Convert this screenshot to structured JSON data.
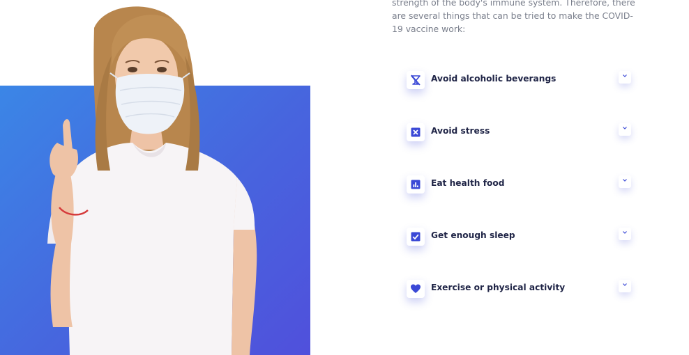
{
  "intro": {
    "text": "strength of the body's immune system. Therefore, there are several things that can be tried to make the COVID-19 vaccine work:"
  },
  "hero": {
    "image_description_icon": "woman-with-mask-illustration"
  },
  "colors": {
    "accent": "#3b49d6",
    "panel_start": "#3b86e6",
    "panel_end": "#5050dc",
    "title": "#1f2446",
    "body": "#7a7f8c"
  },
  "faq": {
    "items": [
      {
        "label": "Avoid alcoholic beverangs",
        "icon": "no-alcohol-icon"
      },
      {
        "label": "Avoid stress",
        "icon": "close-box-icon"
      },
      {
        "label": "Eat health food",
        "icon": "bar-chart-icon"
      },
      {
        "label": "Get enough sleep",
        "icon": "checkbox-icon"
      },
      {
        "label": "Exercise or physical activity",
        "icon": "heart-icon"
      }
    ]
  }
}
